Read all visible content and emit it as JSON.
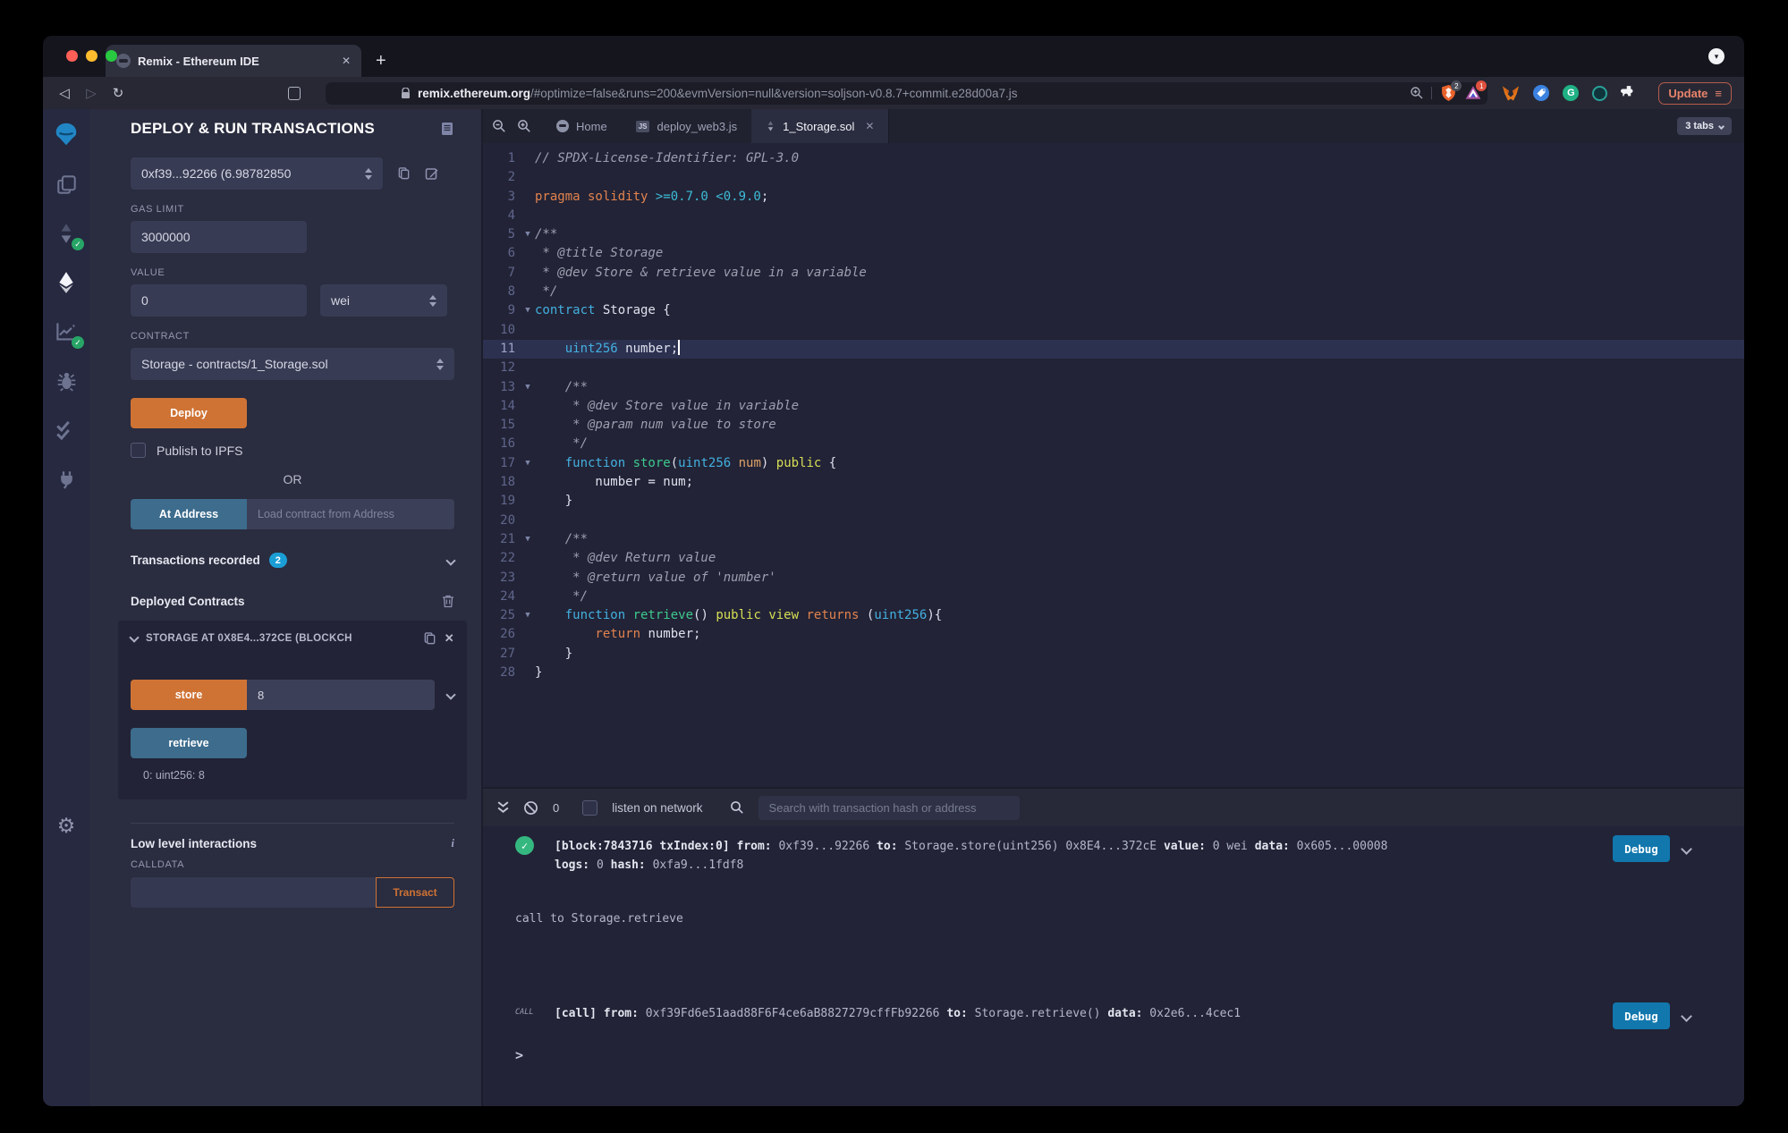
{
  "browser": {
    "tab_title": "Remix - Ethereum IDE",
    "new_tab_glyph": "+",
    "close_glyph": "✕",
    "url_domain": "remix.ethereum.org",
    "url_path": "/#optimize=false&runs=200&evmVersion=null&version=soljson-v0.8.7+commit.e28d00a7.js",
    "shield_badge": "2",
    "rewards_badge": "1",
    "grammarly_letter": "G",
    "update_label": "Update"
  },
  "rail": {
    "items": [
      {
        "icon": "remix-logo-icon",
        "cls": "logo"
      },
      {
        "icon": "file-explorer-icon"
      },
      {
        "icon": "solidity-compiler-icon",
        "badge": "check"
      },
      {
        "icon": "deploy-run-icon",
        "active": true
      },
      {
        "icon": "static-analysis-icon",
        "badge": "check"
      },
      {
        "icon": "debugger-icon"
      },
      {
        "icon": "unit-testing-icon"
      },
      {
        "icon": "plugin-manager-icon"
      }
    ],
    "gear_glyph": "⚙"
  },
  "panel": {
    "title": "DEPLOY & RUN TRANSACTIONS",
    "account_value": "0xf39...92266 (6.98782850",
    "gas_label": "GAS LIMIT",
    "gas_value": "3000000",
    "value_label": "VALUE",
    "value_value": "0",
    "unit_value": "wei",
    "contract_label": "CONTRACT",
    "contract_value": "Storage - contracts/1_Storage.sol",
    "deploy_label": "Deploy",
    "ipfs_label": "Publish to IPFS",
    "or_label": "OR",
    "at_address_label": "At Address",
    "at_address_placeholder": "Load contract from Address",
    "tx_recorded_label": "Transactions recorded",
    "tx_recorded_count": "2",
    "deployed_label": "Deployed Contracts",
    "instance_title": "STORAGE AT 0X8E4...372CE (BLOCKCH",
    "store_label": "store",
    "store_value": "8",
    "retrieve_label": "retrieve",
    "retrieve_result": "0: uint256: 8",
    "low_level_label": "Low level interactions",
    "info_glyph": "i",
    "calldata_label": "CALLDATA",
    "transact_label": "Transact"
  },
  "editor": {
    "tabs": [
      {
        "label": "Home",
        "icon": "home"
      },
      {
        "label": "deploy_web3.js",
        "icon": "js"
      },
      {
        "label": "1_Storage.sol",
        "icon": "sol",
        "active": true,
        "closable": true
      }
    ],
    "tabs_count_label": "3 tabs",
    "lines": [
      {
        "n": 1,
        "s": [
          [
            "c",
            "// SPDX-License-Identifier: GPL-3.0"
          ]
        ]
      },
      {
        "n": 2,
        "s": []
      },
      {
        "n": 3,
        "s": [
          [
            "ko",
            "pragma solidity "
          ],
          [
            "nu",
            ">=0.7.0 <0.9.0"
          ],
          [
            "t",
            ";"
          ]
        ]
      },
      {
        "n": 4,
        "s": []
      },
      {
        "n": 5,
        "f": 1,
        "s": [
          [
            "c",
            "/**"
          ]
        ]
      },
      {
        "n": 6,
        "s": [
          [
            "c",
            " * @title Storage"
          ]
        ]
      },
      {
        "n": 7,
        "s": [
          [
            "c",
            " * @dev Store & retrieve value in a variable"
          ]
        ]
      },
      {
        "n": 8,
        "s": [
          [
            "c",
            " */"
          ]
        ]
      },
      {
        "n": 9,
        "f": 1,
        "s": [
          [
            "kc",
            "contract "
          ],
          [
            "t",
            "Storage {"
          ]
        ]
      },
      {
        "n": 10,
        "s": []
      },
      {
        "n": 11,
        "hl": 1,
        "cur": 1,
        "s": [
          [
            "kc",
            "    uint256 "
          ],
          [
            "t",
            "number;"
          ]
        ]
      },
      {
        "n": 12,
        "s": []
      },
      {
        "n": 13,
        "f": 1,
        "s": [
          [
            "c",
            "    /**"
          ]
        ]
      },
      {
        "n": 14,
        "s": [
          [
            "c",
            "     * @dev Store value in variable"
          ]
        ]
      },
      {
        "n": 15,
        "s": [
          [
            "c",
            "     * @param num value to store"
          ]
        ]
      },
      {
        "n": 16,
        "s": [
          [
            "c",
            "     */"
          ]
        ]
      },
      {
        "n": 17,
        "f": 1,
        "s": [
          [
            "kc",
            "    function "
          ],
          [
            "fn",
            "store"
          ],
          [
            "t",
            "("
          ],
          [
            "kc",
            "uint256 "
          ],
          [
            "pa",
            "num"
          ],
          [
            "t",
            ") "
          ],
          [
            "ky",
            "public"
          ],
          [
            "t",
            " {"
          ]
        ]
      },
      {
        "n": 18,
        "s": [
          [
            "t",
            "        number = num;"
          ]
        ]
      },
      {
        "n": 19,
        "s": [
          [
            "t",
            "    }"
          ]
        ]
      },
      {
        "n": 20,
        "s": []
      },
      {
        "n": 21,
        "f": 1,
        "s": [
          [
            "c",
            "    /**"
          ]
        ]
      },
      {
        "n": 22,
        "s": [
          [
            "c",
            "     * @dev Return value"
          ]
        ]
      },
      {
        "n": 23,
        "s": [
          [
            "c",
            "     * @return value of 'number'"
          ]
        ]
      },
      {
        "n": 24,
        "s": [
          [
            "c",
            "     */"
          ]
        ]
      },
      {
        "n": 25,
        "f": 1,
        "s": [
          [
            "kc",
            "    function "
          ],
          [
            "fn",
            "retrieve"
          ],
          [
            "t",
            "() "
          ],
          [
            "ky",
            "public view "
          ],
          [
            "kr",
            "returns "
          ],
          [
            "t",
            "("
          ],
          [
            "kc",
            "uint256"
          ],
          [
            "t",
            "){"
          ]
        ]
      },
      {
        "n": 26,
        "s": [
          [
            "kr",
            "        return "
          ],
          [
            "t",
            "number;"
          ]
        ]
      },
      {
        "n": 27,
        "s": [
          [
            "t",
            "    }"
          ]
        ]
      },
      {
        "n": 28,
        "s": [
          [
            "t",
            "}"
          ]
        ]
      }
    ]
  },
  "terminal": {
    "block_count": "0",
    "listen_label": "listen on network",
    "search_placeholder": "Search with transaction hash or address",
    "debug_label": "Debug",
    "entries": [
      {
        "type": "tx",
        "icon": "success-check",
        "line1": [
          [
            "b",
            "[block:7843716 txIndex:0]"
          ],
          [
            "t",
            "  "
          ],
          [
            "b",
            "from:"
          ],
          [
            "t",
            " 0xf39...92266 "
          ],
          [
            "b",
            "to:"
          ],
          [
            "t",
            " Storage.store(uint256) 0x8E4...372cE "
          ],
          [
            "b",
            "value:"
          ],
          [
            "t",
            " 0 wei "
          ],
          [
            "b",
            "data:"
          ],
          [
            "t",
            " 0x605...00008 "
          ]
        ],
        "line2": [
          [
            "b",
            "logs:"
          ],
          [
            "t",
            " 0 "
          ],
          [
            "b",
            "hash:"
          ],
          [
            "t",
            " 0xfa9...1fdf8"
          ]
        ]
      },
      {
        "type": "plain",
        "text": "call to Storage.retrieve"
      },
      {
        "type": "call",
        "tag": "CALL",
        "line1": [
          [
            "b",
            "[call]"
          ],
          [
            "t",
            "  "
          ],
          [
            "b",
            "from:"
          ],
          [
            "t",
            " 0xf39Fd6e51aad88F6F4ce6aB8827279cffFb92266 "
          ],
          [
            "b",
            "to:"
          ],
          [
            "t",
            " Storage.retrieve() "
          ],
          [
            "b",
            "data:"
          ],
          [
            "t",
            " 0x2e6...4cec1"
          ]
        ]
      }
    ],
    "prompt": ">"
  },
  "colors": {
    "accent_orange": "#cf7335",
    "steel_blue": "#3d6c8d",
    "debug_blue": "#1177ad",
    "badge_cyan": "#1b9ed6",
    "success_green": "#35b880",
    "panel_bg": "#2a2c3f",
    "editor_bg": "#222336",
    "traffic_red": "#ff5f57",
    "traffic_yellow": "#febc2e",
    "traffic_green": "#28c840"
  }
}
